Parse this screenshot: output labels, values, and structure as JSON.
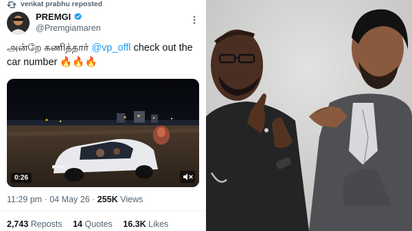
{
  "repost": {
    "text": "venkat prabhu reposted"
  },
  "author": {
    "name": "PREMGI",
    "handle": "@Premgiamaren"
  },
  "tweet": {
    "text_part1": "அன்றே கணித்தார் ",
    "mention": "@vp_offl",
    "text_part2": "  check out the car number ",
    "emojis": "🔥🔥🔥"
  },
  "video": {
    "duration": "0:26"
  },
  "meta": {
    "time": "11:29 pm · 04 May 26 · ",
    "views_count": "255K",
    "views_label": " Views"
  },
  "stats": {
    "reposts_count": "2,743",
    "reposts_label": " Reposts",
    "quotes_count": "14",
    "quotes_label": " Quotes",
    "likes_count": "16.3K",
    "likes_label": " Likes"
  },
  "colors": {
    "accent": "#1d9bf0",
    "text": "#0f1419",
    "muted": "#536471"
  },
  "icons": [
    "repost-icon",
    "verified-badge-icon",
    "more-options-icon",
    "mute-icon"
  ]
}
